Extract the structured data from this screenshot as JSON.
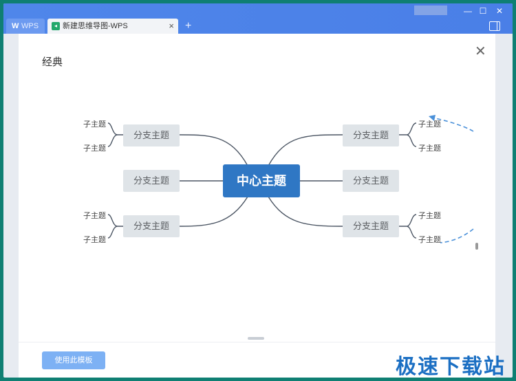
{
  "titlebar": {
    "tabs": [
      {
        "label": "WPS",
        "logo": "W"
      },
      {
        "label": "新建思维导图-WPS",
        "icon": "mindmap-doc-icon"
      }
    ],
    "close_tab": "×",
    "new_tab": "+",
    "min": "—",
    "max": "☐",
    "close": "✕"
  },
  "dialog": {
    "title": "经典",
    "close": "✕",
    "use_template": "使用此模板"
  },
  "mindmap": {
    "center": "中心主题",
    "branch": "分支主题",
    "leaf": "子主题",
    "colors": {
      "center": "#2f77c4",
      "branch": "#dfe4e8",
      "line": "#4b5563",
      "arrow": "#4a90d9"
    }
  },
  "watermark": "极速下载站"
}
